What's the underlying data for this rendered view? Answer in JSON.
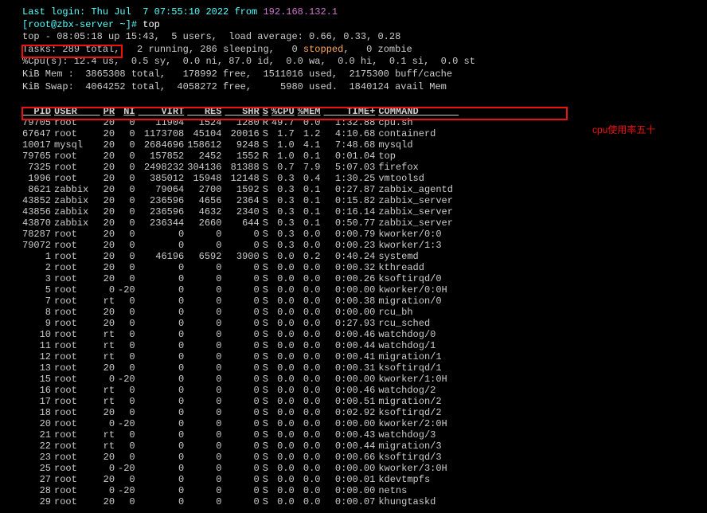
{
  "login": {
    "prefix": "Last login: ",
    "date": "Thu Jul  7 07:55:10 2022",
    "from": " from ",
    "ip": "192.168.132.1"
  },
  "prompt": {
    "open": "[",
    "user": "root",
    "at": "@",
    "host": "zbx-server",
    "path": " ~",
    "close": "]# ",
    "cmd": "top"
  },
  "summary": {
    "l1": "top - 08:05:18 up 15:43,  5 users,  load average: 0.66, 0.33, 0.28",
    "l2a": "Tasks: ",
    "l2b": "289",
    "l2c": " total,   ",
    "l2d": "2",
    "l2e": " running, ",
    "l2f": "286",
    "l2g": " sleeping,   ",
    "l2h": "0",
    "l2i": " stopped",
    "l2j": ",   ",
    "l2k": "0",
    "l2l": " zombie",
    "cpu": "%Cpu(s): 12.4 us,  0.5 sy,  0.0 ni, 87.0 id,  0.0 wa,  0.0 hi,  0.1 si,  0.0 st",
    "mem": "KiB Mem :  3865308 total,   178992 free,  1511016 used,  2175300 buff/cache",
    "swap": "KiB Swap:  4064252 total,  4058272 free,     5980 used.  1840124 avail Mem"
  },
  "headers": [
    "  PID",
    "USER    ",
    "PR",
    "NI",
    "    VIRT",
    "   RES",
    "   SHR",
    "S",
    "%CPU",
    "%MEM",
    "    TIME+",
    "COMMAND       "
  ],
  "rows": [
    [
      "79705",
      "root    ",
      "20",
      "  0",
      "   11904",
      "  1524",
      "  1280",
      "R",
      "49.7",
      " 0.0",
      "  1:32.88",
      "cpu.sh        "
    ],
    [
      "67647",
      "root    ",
      "20",
      "  0",
      " 1173708",
      " 45104",
      " 20016",
      "S",
      " 1.7",
      " 1.2",
      "  4:10.68",
      "containerd    "
    ],
    [
      "10017",
      "mysql   ",
      "20",
      "  0",
      " 2684696",
      "158612",
      "  9248",
      "S",
      " 1.0",
      " 4.1",
      "  7:48.68",
      "mysqld        "
    ],
    [
      "79765",
      "root    ",
      "20",
      "  0",
      "  157852",
      "  2452",
      "  1552",
      "R",
      " 1.0",
      " 0.1",
      "  0:01.04",
      "top           "
    ],
    [
      " 7325",
      "root    ",
      "20",
      "  0",
      " 2498232",
      "304136",
      " 81388",
      "S",
      " 0.7",
      " 7.9",
      "  5:07.03",
      "firefox       "
    ],
    [
      " 1996",
      "root    ",
      "20",
      "  0",
      "  385012",
      " 15948",
      " 12148",
      "S",
      " 0.3",
      " 0.4",
      "  1:30.25",
      "vmtoolsd      "
    ],
    [
      " 8621",
      "zabbix  ",
      "20",
      "  0",
      "   79064",
      "  2700",
      "  1592",
      "S",
      " 0.3",
      " 0.1",
      "  0:27.87",
      "zabbix_agentd "
    ],
    [
      "43852",
      "zabbix  ",
      "20",
      "  0",
      "  236596",
      "  4656",
      "  2364",
      "S",
      " 0.3",
      " 0.1",
      "  0:15.82",
      "zabbix_server "
    ],
    [
      "43856",
      "zabbix  ",
      "20",
      "  0",
      "  236596",
      "  4632",
      "  2340",
      "S",
      " 0.3",
      " 0.1",
      "  0:16.14",
      "zabbix_server "
    ],
    [
      "43870",
      "zabbix  ",
      "20",
      "  0",
      "  236344",
      "  2660",
      "   644",
      "S",
      " 0.3",
      " 0.1",
      "  0:50.77",
      "zabbix_server "
    ],
    [
      "78287",
      "root    ",
      "20",
      "  0",
      "       0",
      "     0",
      "     0",
      "S",
      " 0.3",
      " 0.0",
      "  0:00.79",
      "kworker/0:0   "
    ],
    [
      "79072",
      "root    ",
      "20",
      "  0",
      "       0",
      "     0",
      "     0",
      "S",
      " 0.3",
      " 0.0",
      "  0:00.23",
      "kworker/1:3   "
    ],
    [
      "    1",
      "root    ",
      "20",
      "  0",
      "   46196",
      "  6592",
      "  3900",
      "S",
      " 0.0",
      " 0.2",
      "  0:40.24",
      "systemd       "
    ],
    [
      "    2",
      "root    ",
      "20",
      "  0",
      "       0",
      "     0",
      "     0",
      "S",
      " 0.0",
      " 0.0",
      "  0:00.32",
      "kthreadd      "
    ],
    [
      "    3",
      "root    ",
      "20",
      "  0",
      "       0",
      "     0",
      "     0",
      "S",
      " 0.0",
      " 0.0",
      "  0:00.26",
      "ksoftirqd/0   "
    ],
    [
      "    5",
      "root    ",
      " 0",
      "-20",
      "       0",
      "     0",
      "     0",
      "S",
      " 0.0",
      " 0.0",
      "  0:00.00",
      "kworker/0:0H  "
    ],
    [
      "    7",
      "root    ",
      "rt",
      "  0",
      "       0",
      "     0",
      "     0",
      "S",
      " 0.0",
      " 0.0",
      "  0:00.38",
      "migration/0   "
    ],
    [
      "    8",
      "root    ",
      "20",
      "  0",
      "       0",
      "     0",
      "     0",
      "S",
      " 0.0",
      " 0.0",
      "  0:00.00",
      "rcu_bh        "
    ],
    [
      "    9",
      "root    ",
      "20",
      "  0",
      "       0",
      "     0",
      "     0",
      "S",
      " 0.0",
      " 0.0",
      "  0:27.93",
      "rcu_sched     "
    ],
    [
      "   10",
      "root    ",
      "rt",
      "  0",
      "       0",
      "     0",
      "     0",
      "S",
      " 0.0",
      " 0.0",
      "  0:00.46",
      "watchdog/0    "
    ],
    [
      "   11",
      "root    ",
      "rt",
      "  0",
      "       0",
      "     0",
      "     0",
      "S",
      " 0.0",
      " 0.0",
      "  0:00.44",
      "watchdog/1    "
    ],
    [
      "   12",
      "root    ",
      "rt",
      "  0",
      "       0",
      "     0",
      "     0",
      "S",
      " 0.0",
      " 0.0",
      "  0:00.41",
      "migration/1   "
    ],
    [
      "   13",
      "root    ",
      "20",
      "  0",
      "       0",
      "     0",
      "     0",
      "S",
      " 0.0",
      " 0.0",
      "  0:00.31",
      "ksoftirqd/1   "
    ],
    [
      "   15",
      "root    ",
      " 0",
      "-20",
      "       0",
      "     0",
      "     0",
      "S",
      " 0.0",
      " 0.0",
      "  0:00.00",
      "kworker/1:0H  "
    ],
    [
      "   16",
      "root    ",
      "rt",
      "  0",
      "       0",
      "     0",
      "     0",
      "S",
      " 0.0",
      " 0.0",
      "  0:00.46",
      "watchdog/2    "
    ],
    [
      "   17",
      "root    ",
      "rt",
      "  0",
      "       0",
      "     0",
      "     0",
      "S",
      " 0.0",
      " 0.0",
      "  0:00.51",
      "migration/2   "
    ],
    [
      "   18",
      "root    ",
      "20",
      "  0",
      "       0",
      "     0",
      "     0",
      "S",
      " 0.0",
      " 0.0",
      "  0:02.92",
      "ksoftirqd/2   "
    ],
    [
      "   20",
      "root    ",
      " 0",
      "-20",
      "       0",
      "     0",
      "     0",
      "S",
      " 0.0",
      " 0.0",
      "  0:00.00",
      "kworker/2:0H  "
    ],
    [
      "   21",
      "root    ",
      "rt",
      "  0",
      "       0",
      "     0",
      "     0",
      "S",
      " 0.0",
      " 0.0",
      "  0:00.43",
      "watchdog/3    "
    ],
    [
      "   22",
      "root    ",
      "rt",
      "  0",
      "       0",
      "     0",
      "     0",
      "S",
      " 0.0",
      " 0.0",
      "  0:00.44",
      "migration/3   "
    ],
    [
      "   23",
      "root    ",
      "20",
      "  0",
      "       0",
      "     0",
      "     0",
      "S",
      " 0.0",
      " 0.0",
      "  0:00.66",
      "ksoftirqd/3   "
    ],
    [
      "   25",
      "root    ",
      " 0",
      "-20",
      "       0",
      "     0",
      "     0",
      "S",
      " 0.0",
      " 0.0",
      "  0:00.00",
      "kworker/3:0H  "
    ],
    [
      "   27",
      "root    ",
      "20",
      "  0",
      "       0",
      "     0",
      "     0",
      "S",
      " 0.0",
      " 0.0",
      "  0:00.01",
      "kdevtmpfs     "
    ],
    [
      "   28",
      "root    ",
      " 0",
      "-20",
      "       0",
      "     0",
      "     0",
      "S",
      " 0.0",
      " 0.0",
      "  0:00.00",
      "netns         "
    ],
    [
      "   29",
      "root    ",
      "20",
      "  0",
      "       0",
      "     0",
      "     0",
      "S",
      " 0.0",
      " 0.0",
      "  0:00.07",
      "khungtaskd    "
    ]
  ],
  "annotation": "cpu使用率五十"
}
